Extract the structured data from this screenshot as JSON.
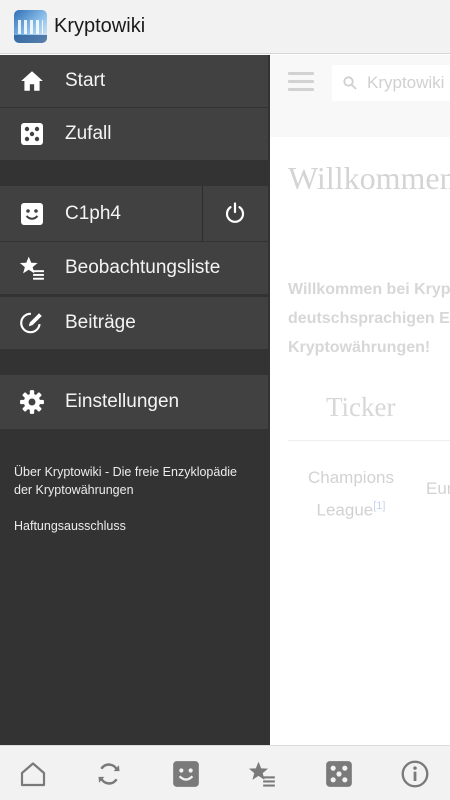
{
  "app": {
    "title": "Kryptowiki"
  },
  "background": {
    "search_placeholder": "Kryptowiki",
    "welcome_title": "Willkommen",
    "welcome_lines": [
      "Willkommen bei Kryp",
      "deutschsprachigen E",
      "Kryptowährungen!"
    ],
    "ticker_title": "Ticker",
    "ticker_cell_1": [
      "Champions",
      "League"
    ],
    "ticker_cell_1_ref": "[1]",
    "ticker_cell_2": "Eur"
  },
  "drawer": {
    "items": [
      {
        "label": "Start",
        "icon": "home-icon"
      },
      {
        "label": "Zufall",
        "icon": "dice-icon"
      },
      {
        "label": "C1ph4",
        "icon": "user-face-icon"
      },
      {
        "label": "Beobachtungsliste",
        "icon": "watchlist-star-icon"
      },
      {
        "label": "Beiträge",
        "icon": "contributions-pencil-icon"
      },
      {
        "label": "Einstellungen",
        "icon": "gear-icon"
      }
    ],
    "logout_icon": "power-icon",
    "footer_about": "Über Kryptowiki - Die freie Enzyklopädie der Kryptowährungen",
    "footer_disclaimer": "Haftungsausschluss"
  },
  "bottom_bar": {
    "icons": [
      "home-icon",
      "refresh-icon",
      "user-face-icon",
      "watchlist-star-icon",
      "dice-icon",
      "info-icon"
    ]
  },
  "colors": {
    "drawer_bg": "#333333",
    "drawer_item_bg": "#414141",
    "bar_bg": "#f2f2f2",
    "icon_gray": "#7a7a7a"
  }
}
